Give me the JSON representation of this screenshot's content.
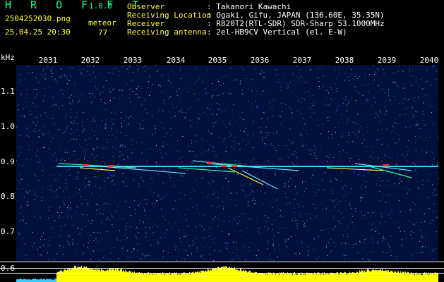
{
  "header": {
    "app_title": "H R O F F T",
    "app_version": "1.0.0",
    "file_name": "2504252030.png",
    "datetime": "25.04.25 20:30",
    "meteor_label": "meteor",
    "meteor_count": "77"
  },
  "info": [
    {
      "key": "Observer",
      "value": ": Takanori Kawachi"
    },
    {
      "key": "Receiving Location",
      "value": ": Ogaki, Gifu, JAPAN (136.60E, 35.35N)"
    },
    {
      "key": "Receiver",
      "value": ": R820T2(RTL-SDR) SDR-Sharp 53.1000MHz"
    },
    {
      "key": "Receiving antenna",
      "value": ": 2el-HB9CV Vertical (el. E-W)"
    }
  ],
  "axis": {
    "unit": "kHz",
    "y_ticks": [
      "1.1",
      "1.0",
      "0.9",
      "0.8",
      "0.7",
      "0.6"
    ],
    "x_ticks": [
      "2031",
      "2032",
      "2033",
      "2034",
      "2035",
      "2036",
      "2037",
      "2038",
      "2039",
      "2040"
    ]
  },
  "colors": {
    "title_green": "#18ff8a",
    "label_yellow": "#ffff33",
    "spectrogram_bg": "#00103a",
    "carrier_cyan": "#33ccff",
    "meteor_red": "#ff3030"
  }
}
